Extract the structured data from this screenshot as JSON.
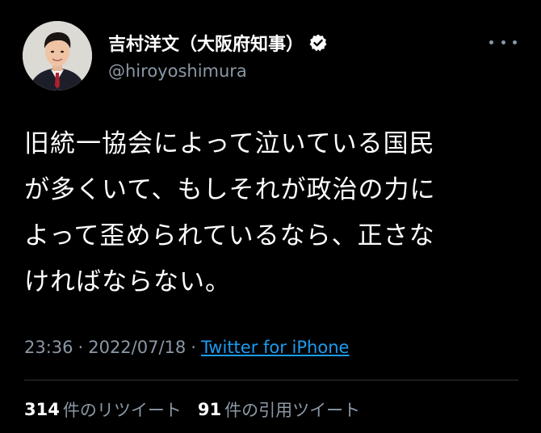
{
  "author": {
    "display_name": "吉村洋文（大阪府知事）",
    "handle": "@hiroyoshimura",
    "verified_icon": "verified-badge-icon"
  },
  "tweet": {
    "lines": [
      "旧統一協会によって泣いている国民",
      "が多くいて、もしそれが政治の力に",
      "よって歪められているなら、正さな",
      "ければならない。"
    ]
  },
  "meta": {
    "time": "23:36",
    "separator": "·",
    "date": "2022/07/18",
    "source": "Twitter for iPhone"
  },
  "stats": {
    "retweets_count": "314",
    "retweets_label": "件のリツイート",
    "quotes_count": "91",
    "quotes_label": "件の引用ツイート"
  },
  "colors": {
    "background": "#000000",
    "text": "#ffffff",
    "secondary": "#8b98a5",
    "link": "#1d9bf0",
    "divider": "#2f3336"
  }
}
